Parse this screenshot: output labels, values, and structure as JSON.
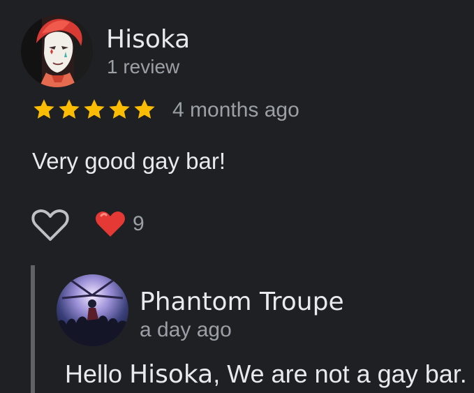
{
  "review": {
    "author": {
      "name": "Hisoka",
      "meta": "1 review",
      "avatar_icon": "profile-photo-icon"
    },
    "rating": {
      "stars": 5,
      "max": 5,
      "color": "#fbbc04"
    },
    "time": "4 months ago",
    "text": "Very good gay bar!",
    "actions": {
      "like_icon": "heart-outline-icon",
      "reaction_icon": "red-heart-icon",
      "reaction_count": "9"
    }
  },
  "reply": {
    "author": {
      "name": "Phantom Troupe",
      "avatar_icon": "owner-photo-icon"
    },
    "time": "a day ago",
    "greeting": "Hello",
    "mention": "Hisoka",
    "body": ", We are not a gay bar."
  },
  "colors": {
    "background": "#1f2023",
    "primary_text": "#e8eaed",
    "secondary_text": "#9aa0a6",
    "star": "#fbbc04",
    "heart": "#e53935",
    "rule": "#5f6368"
  }
}
